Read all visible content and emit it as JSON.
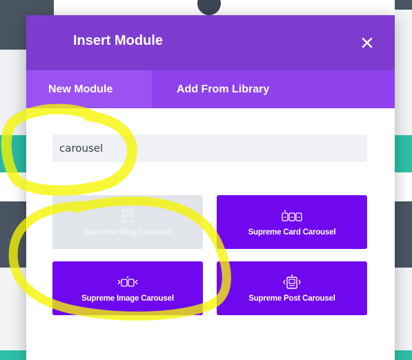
{
  "modal": {
    "title": "Insert Module",
    "tabs": [
      {
        "label": "New Module",
        "active": true
      },
      {
        "label": "Add From Library",
        "active": false
      }
    ],
    "search": {
      "value": "carousel",
      "placeholder": ""
    },
    "modules": [
      {
        "label": "Supreme Blog Carousel",
        "icon": "blog-carousel-icon",
        "state": "faded"
      },
      {
        "label": "Supreme Card Carousel",
        "icon": "card-carousel-icon",
        "state": "normal"
      },
      {
        "label": "Supreme Image Carousel",
        "icon": "image-carousel-icon",
        "state": "normal"
      },
      {
        "label": "Supreme Post Carousel",
        "icon": "post-carousel-icon",
        "state": "normal"
      }
    ]
  },
  "colors": {
    "header": "#7e3bd0",
    "tab_bar": "#8f42ec",
    "tab_active": "#9a52f3",
    "module_card": "#6f08ef",
    "annotation": "#f5f500"
  }
}
